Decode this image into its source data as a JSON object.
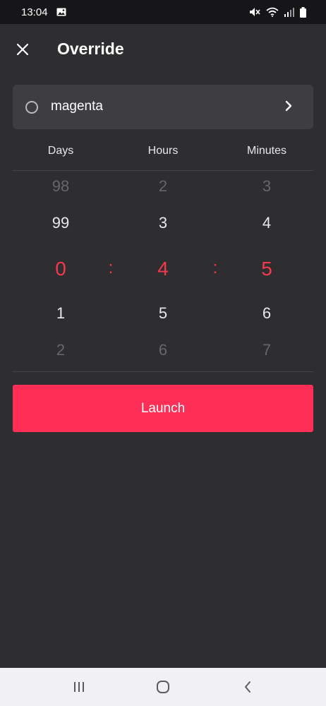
{
  "status_bar": {
    "time": "13:04",
    "icons": [
      "image-icon",
      "mute-icon",
      "wifi-icon",
      "signal-icon",
      "battery-icon"
    ]
  },
  "header": {
    "title": "Override",
    "close_icon": "close-icon"
  },
  "target": {
    "label": "magenta",
    "selected": false
  },
  "picker": {
    "headers": {
      "days": "Days",
      "hours": "Hours",
      "minutes": "Minutes"
    },
    "separator": ":",
    "days": {
      "far_above": "98",
      "above": "99",
      "selected": "0",
      "below": "1",
      "far_below": "2"
    },
    "hours": {
      "far_above": "2",
      "above": "3",
      "selected": "4",
      "below": "5",
      "far_below": "6"
    },
    "minutes": {
      "far_above": "3",
      "above": "4",
      "selected": "5",
      "below": "6",
      "far_below": "7"
    }
  },
  "launch_label": "Launch",
  "nav_bar": {
    "icons": [
      "recent-apps-icon",
      "home-icon",
      "back-icon"
    ]
  },
  "colors": {
    "background": "#2e2e30",
    "accent": "#fe2e57",
    "selected_value": "#f2394f",
    "card": "#3e3e42"
  }
}
